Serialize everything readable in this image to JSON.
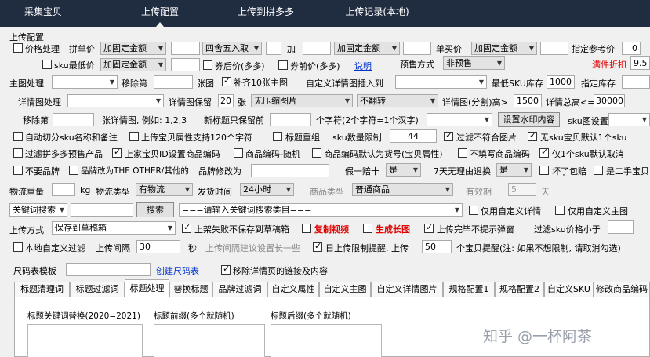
{
  "top_nav": {
    "tabs": [
      "采集宝贝",
      "上传配置",
      "上传到拼多多",
      "上传记录(本地)"
    ],
    "active_index": 1
  },
  "config": {
    "section_title": "上传配置",
    "price": {
      "cb_label": "价格处理",
      "unit_label": "拼单价",
      "mode": "加固定金额",
      "rounding": "四舍五入取",
      "add_label": "加",
      "mode2": "加固定金额",
      "single_label": "单买价",
      "single_mode": "加固定金额",
      "ref_label": "指定参考价",
      "ref_value": "0"
    },
    "sku": {
      "cb_label": "sku最低价",
      "mode": "加固定金额",
      "after_coupon": "券后价(多多)",
      "before_coupon": "券前价(多多)",
      "explain_link": "说明",
      "presale_label": "预售方式",
      "presale_value": "非预售",
      "discount_label": "满件折扣",
      "discount_value": "9.5"
    },
    "main_img": {
      "label": "主图处理",
      "remove_label": "移除第",
      "page_label": "张图",
      "pad_label": "补齐10张主图",
      "insert_label": "自定义详情图插入到",
      "min_stock_label": "最低SKU库存",
      "min_stock_value": "1000",
      "stock_label": "指定库存"
    },
    "detail_img": {
      "label": "详情图处理",
      "keep_label": "详情图保留",
      "keep_value": "20",
      "unit": "张",
      "compress": "无压缩图片",
      "flip": "不翻转",
      "split_label": "详情图(分割)高>",
      "split_value": "1500",
      "total_label": "详情总高<=",
      "total_value": "30000"
    },
    "remove_detail": {
      "label": "移除第",
      "example": "张详情图, 例如: 1,2,3",
      "keep_before": "新标题只保留前",
      "chars_label": "个字符(2个字符=1个汉字)",
      "watermark_btn": "设置水印内容",
      "sku_img_label": "sku图设置"
    },
    "row_opts1": {
      "auto_cut": "自动切分sku名称和备注",
      "title_len": "上传宝贝属性支持120个字符",
      "title_regroup": "标题重组",
      "sku_limit_label": "sku数量限制",
      "sku_limit_value": "44",
      "filter_img": "过滤不符合图片",
      "no_sku": "无sku宝贝默认1个sku"
    },
    "row_opts2": {
      "filter_presale": "过滤拼多多预售产品",
      "use_id": "上家宝贝ID设置商品编码",
      "code_random": "商品编码-随机",
      "code_default": "商品编码默认为货号(宝贝属性)",
      "no_code": "不填写商品编码",
      "only_one": "仅1个sku默认取消"
    },
    "row_opts3": {
      "no_brand": "不要品牌",
      "brand_to": "品牌改为THE OTHER/其他的",
      "brand_edit_label": "品牌修改为",
      "fake_label": "假一赔十",
      "fake_value": "是",
      "return_label": "7天无理由退换",
      "return_value": "是",
      "broken_pay": "坏了包赔",
      "second_hand": "是二手宝贝"
    },
    "logistics": {
      "weight_label": "物流重量",
      "weight_unit": "kg",
      "type_label": "物流类型",
      "type_value": "有物流",
      "ship_label": "发货时间",
      "ship_value": "24小时",
      "goods_type_label": "商品类型",
      "goods_type_value": "普通商品",
      "valid_label": "有效期",
      "valid_value": "5",
      "valid_unit": "天"
    },
    "keyword": {
      "mode": "关键词搜索",
      "search_btn": "搜索",
      "category_placeholder": "===请输入关键词搜索类目===",
      "only_detail": "仅用自定义详情",
      "only_main": "仅用自定义主图"
    },
    "upload": {
      "label": "上传方式",
      "mode": "保存到草稿箱",
      "not_save_fail": "上架失败不保存到草稿箱",
      "copy_video": "复制视频",
      "long_img": "生成长图",
      "no_popup": "上传完毕不提示弹窗",
      "filter_sku_label": "过滤sku价格小于"
    },
    "interval": {
      "local_filter": "本地自定义过滤",
      "interval_label": "上传间隔",
      "interval_value": "30",
      "sec": "秒",
      "suggest": "上传间隔建议设置长一些",
      "daily_limit": "日上传限制提醒, 上传",
      "daily_value": "50",
      "daily_note": "个宝贝提醒(注: 如果不想限制, 请取消勾选)"
    },
    "size_tpl": {
      "label": "尺码表模板",
      "create_link": "创建尺码表",
      "remove_links": "移除详情页的链接及内容"
    }
  },
  "bottom_tabs": {
    "tabs": [
      "标题清理词",
      "标题过滤词",
      "标题处理",
      "替换标题",
      "品牌过滤词",
      "自定义属性",
      "自定义主图",
      "自定义详情图片",
      "规格配置1",
      "规格配置2",
      "自定义SKU",
      "修改商品编码"
    ],
    "active_index": 2
  },
  "title_panel": {
    "kw_replace": "标题关键词替换(2020=2021)",
    "prefix": "标题前缀(多个就随机)",
    "suffix": "标题后缀(多个就随机)"
  },
  "watermark": "知乎 @一杯阿茶"
}
